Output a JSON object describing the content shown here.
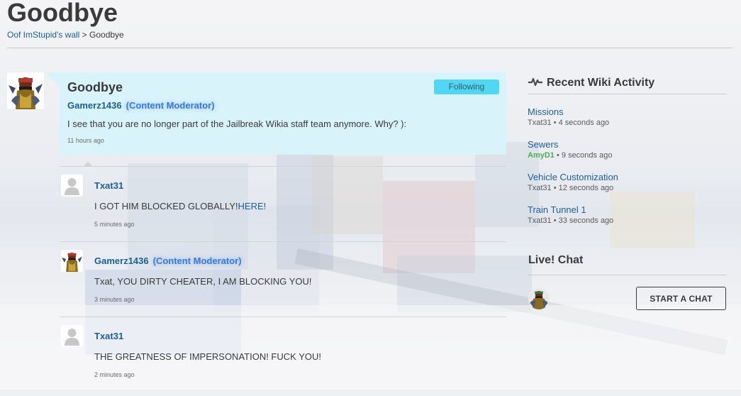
{
  "page": {
    "title": "Goodbye",
    "breadcrumb": {
      "parent": "Oof ImStupid's wall",
      "separator": ">",
      "current": "Goodbye"
    }
  },
  "thread": {
    "title": "Goodbye",
    "follow_label": "Following",
    "author": "Gamerz1436",
    "author_tag": "(Content Moderator)",
    "body": "I see that you are no longer part of the Jailbreak Wikia staff team anymore.  Why? ):",
    "time": "11 hours ago",
    "avatar_icon": "user-avatar-icon"
  },
  "replies": [
    {
      "author": "Txat31",
      "author_tag": "",
      "body": "I GOT HIM BLOCKED GLOBALLY!",
      "link": "HERE!",
      "time": "5 minutes ago",
      "avatar_icon": "default-avatar-icon"
    },
    {
      "author": "Gamerz1436",
      "author_tag": "(Content Moderator)",
      "body": "Txat, YOU DIRTY CHEATER, I AM BLOCKING YOU!",
      "link": "",
      "time": "3 minutes ago",
      "avatar_icon": "user-avatar-icon"
    },
    {
      "author": "Txat31",
      "author_tag": "",
      "body": "THE GREATNESS OF IMPERSONATION! FUCK YOU!",
      "link": "",
      "time": "2 minutes ago",
      "avatar_icon": "default-avatar-icon"
    }
  ],
  "sidebar": {
    "activity": {
      "heading": "Recent Wiki Activity",
      "icon": "activity-pulse-icon",
      "items": [
        {
          "title": "Missions",
          "user": "Txat31",
          "sep": "•",
          "time": "4 seconds ago",
          "user_color": "#5a5a5a"
        },
        {
          "title": "Sewers",
          "user": "AmyD1",
          "sep": "•",
          "time": "9 seconds ago",
          "user_color": "#4caf50"
        },
        {
          "title": "Vehicle Customization",
          "user": "Txat31",
          "sep": "•",
          "time": "12 seconds ago",
          "user_color": "#5a5a5a"
        },
        {
          "title": "Train Tunnel 1",
          "user": "Txat31",
          "sep": "•",
          "time": "33 seconds ago",
          "user_color": "#5a5a5a"
        }
      ]
    },
    "chat": {
      "heading": "Live! Chat",
      "button_label": "START A CHAT"
    }
  },
  "colors": {
    "link": "#1a5f99",
    "moderator_tag": "#3b7ad9",
    "thread_bg": "#d9f3fb",
    "follow_button": "#4fd7f4",
    "active_user": "#4caf50"
  }
}
